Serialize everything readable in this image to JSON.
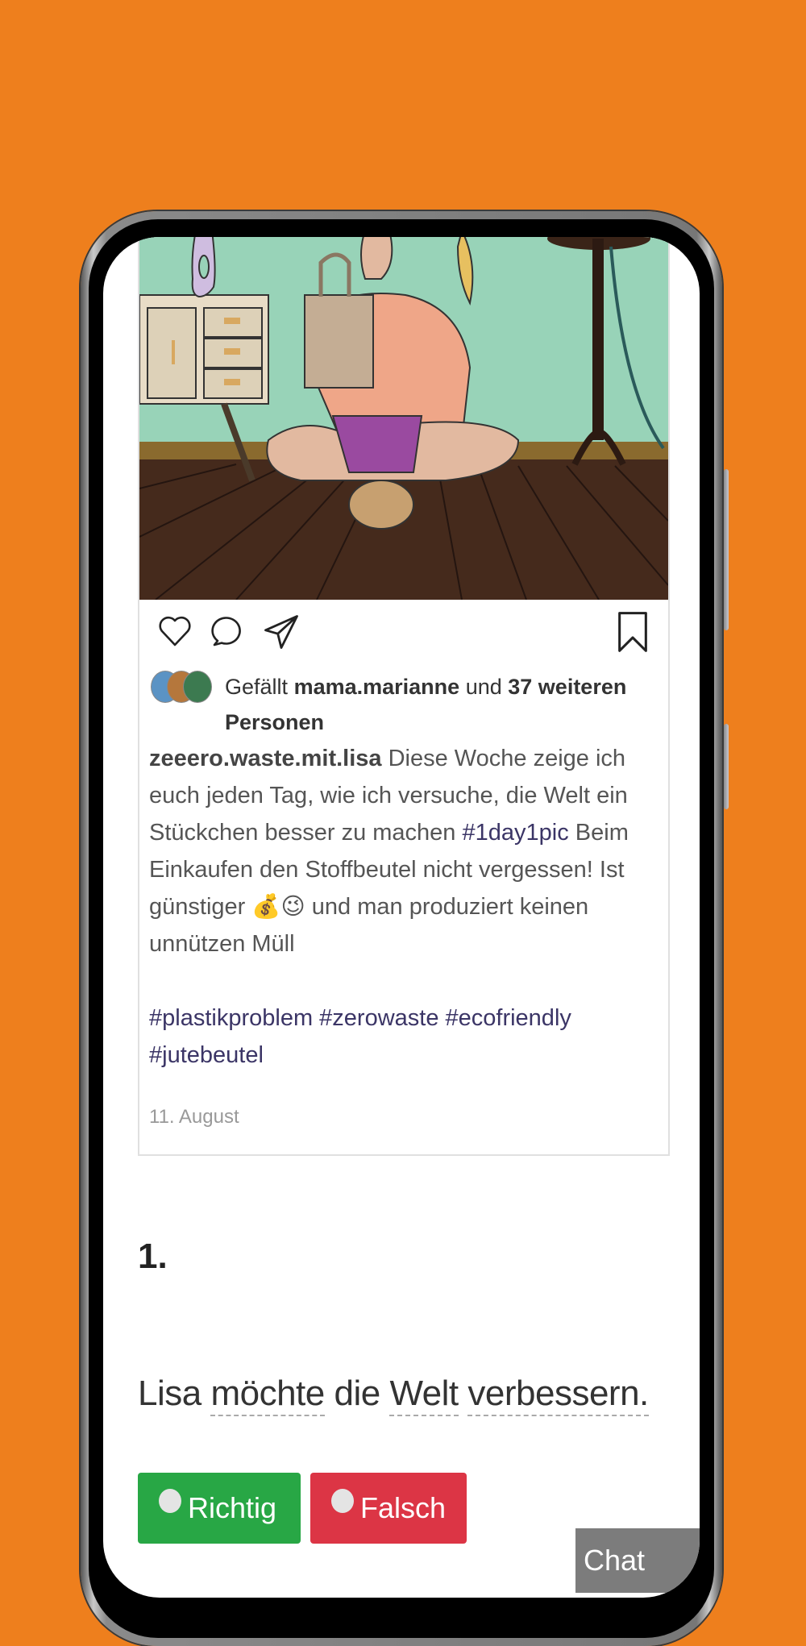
{
  "colors": {
    "background": "#ee7f1d",
    "hashtag": "#3b3566",
    "true_button": "#28a745",
    "false_button": "#dc3545",
    "chat_button": "#7c7c7c"
  },
  "post": {
    "image_description": "Comic illustration of a woman sitting cross-legged on a wooden floor holding up a cloth bag",
    "actions": {
      "like_icon": "heart-icon",
      "comment_icon": "speech-bubble-icon",
      "share_icon": "paper-plane-icon",
      "save_icon": "bookmark-icon"
    },
    "likes": {
      "prefix": "Gefällt",
      "user": "mama.marianne",
      "middle": "und",
      "others": "37 weiteren Personen"
    },
    "caption": {
      "username": "zeeero.waste.mit.lisa",
      "text1": "Diese Woche zeige ich euch jeden Tag, wie ich versuche, die Welt ein Stückchen besser zu machen",
      "hashtag1": "#1day1pic",
      "text2": "Beim Einkaufen den Stoffbeutel nicht vergessen! Ist günstiger",
      "emoji": "💰😉",
      "text3": "und man produziert keinen unnützen Müll"
    },
    "tags": "#plastikproblem #zerowaste #ecofriendly #jutebeutel",
    "date": "11. August"
  },
  "question": {
    "number": "1.",
    "words": [
      "Lisa",
      "möchte",
      "die",
      "Welt",
      "verbessern."
    ],
    "options": {
      "true_label": "Richtig",
      "false_label": "Falsch"
    }
  },
  "chat": {
    "label": "Chat"
  }
}
